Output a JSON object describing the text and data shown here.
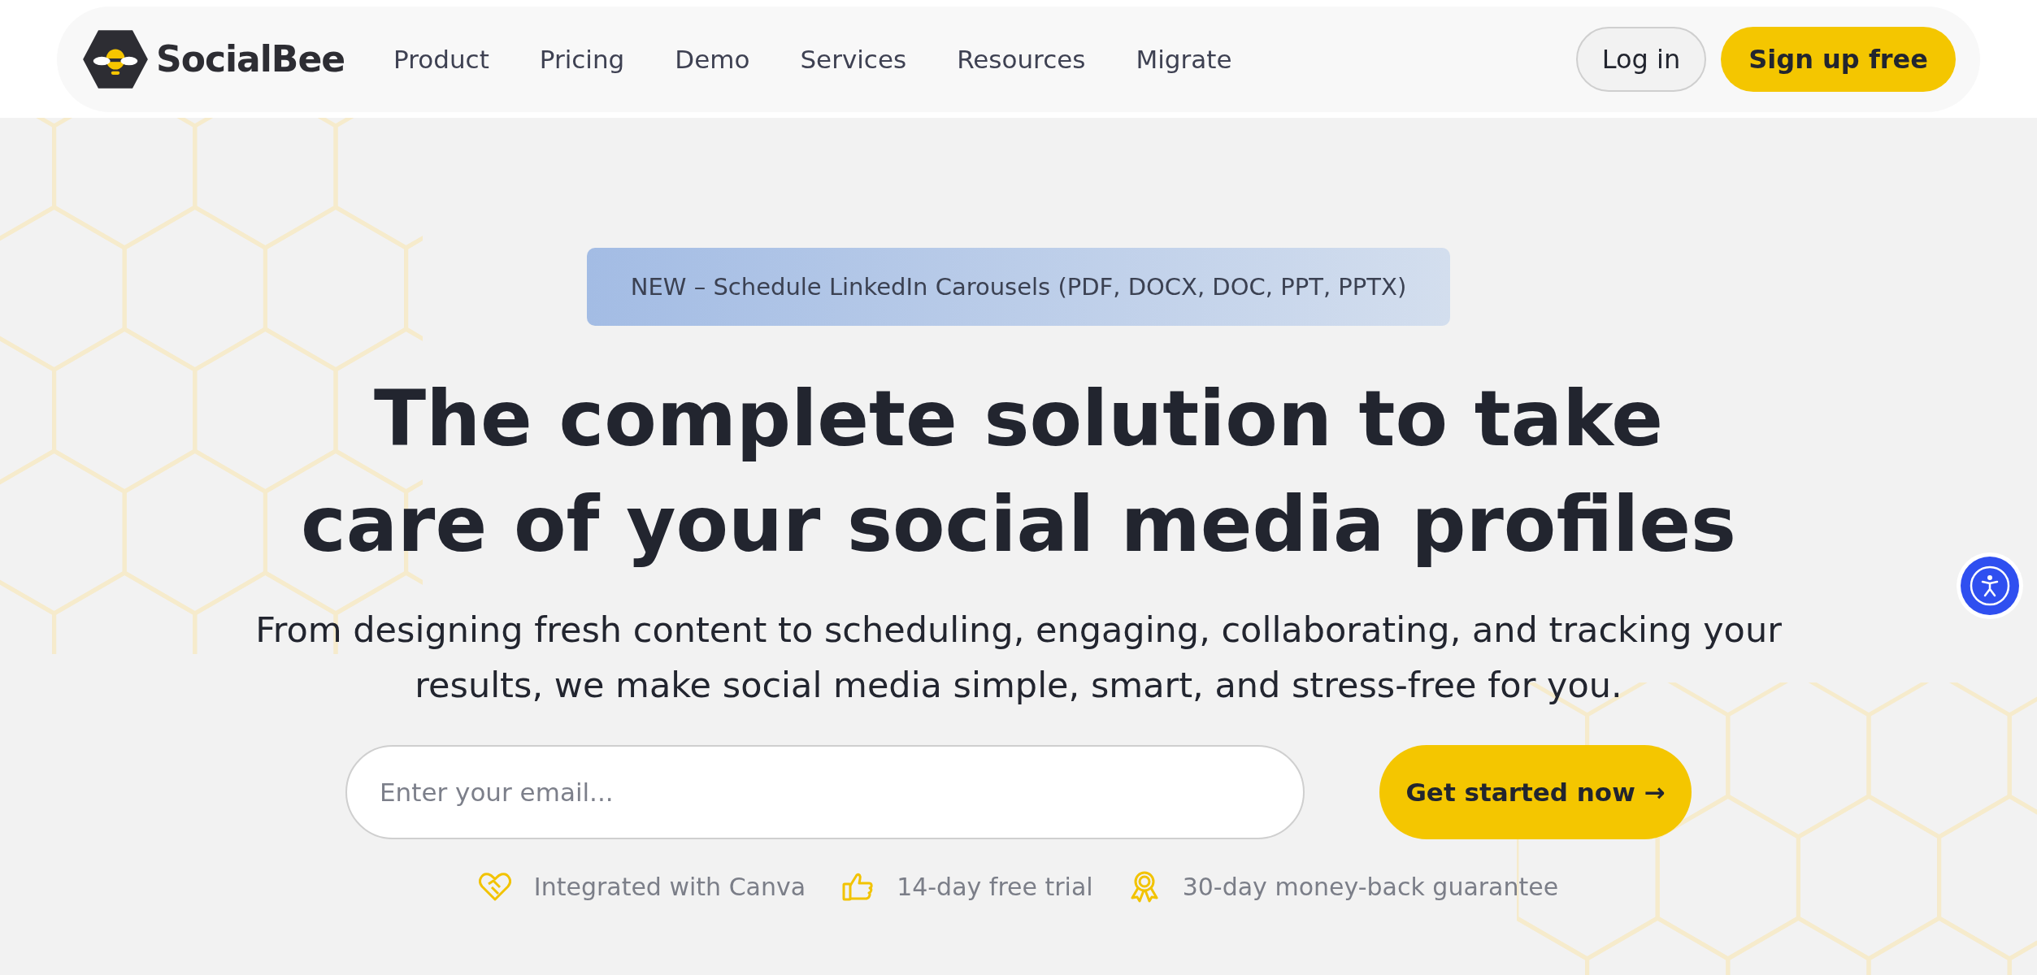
{
  "header": {
    "logo": "SocialBee",
    "nav": [
      {
        "label": "Product"
      },
      {
        "label": "Pricing"
      },
      {
        "label": "Demo"
      },
      {
        "label": "Services"
      },
      {
        "label": "Resources"
      },
      {
        "label": "Migrate"
      }
    ],
    "login": "Log in",
    "signup": "Sign up free"
  },
  "hero": {
    "announcement": "NEW – Schedule LinkedIn Carousels (PDF, DOCX, DOC, PPT, PPTX)",
    "headline": "The complete solution to take care of your social media profiles",
    "subtitle": "From designing fresh content to scheduling, engaging, collaborating, and tracking your results, we make social media simple, smart, and stress-free for you.",
    "email": {
      "placeholder": "Enter your email..."
    },
    "cta": "Get started now →",
    "features": [
      {
        "kind": "heart",
        "text": "Integrated with Canva"
      },
      {
        "kind": "thumb",
        "text": "14-day free trial"
      },
      {
        "kind": "award",
        "text": "30-day money-back guarantee"
      }
    ]
  }
}
